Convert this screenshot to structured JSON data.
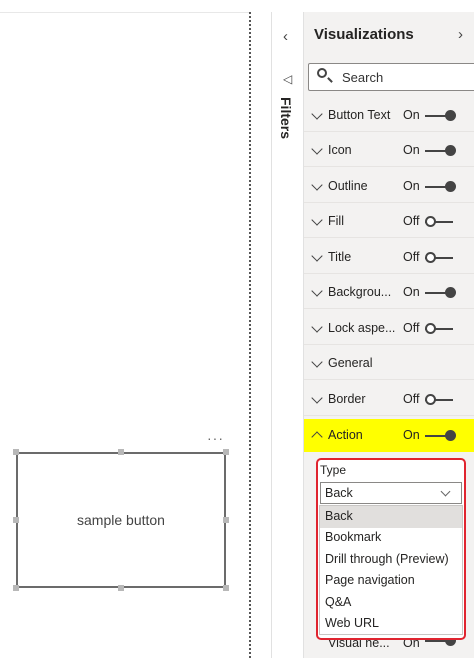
{
  "canvas": {
    "button_text": "sample button",
    "more_options": "···"
  },
  "filters_pane": {
    "label": "Filters",
    "collapse_chevron": "‹",
    "filter_icon": "◁"
  },
  "visualizations": {
    "title": "Visualizations",
    "collapse_chevron": "›",
    "search_placeholder": "Search",
    "sections": [
      {
        "label": "Button Text",
        "state": "On"
      },
      {
        "label": "Icon",
        "state": "On"
      },
      {
        "label": "Outline",
        "state": "On"
      },
      {
        "label": "Fill",
        "state": "Off"
      },
      {
        "label": "Title",
        "state": "Off"
      },
      {
        "label": "Backgrou...",
        "state": "On"
      },
      {
        "label": "Lock aspe...",
        "state": "Off"
      },
      {
        "label": "General",
        "state": ""
      },
      {
        "label": "Border",
        "state": "Off"
      },
      {
        "label": "Action",
        "state": "On"
      }
    ],
    "action": {
      "type_label": "Type",
      "selected_value": "Back",
      "options": [
        "Back",
        "Bookmark",
        "Drill through (Preview)",
        "Page navigation",
        "Q&A",
        "Web URL"
      ]
    },
    "partial_section": {
      "label": "Visual he...",
      "state": "On"
    }
  },
  "colors": {
    "highlight": "#ffff00",
    "outline_red": "#e0242f",
    "pane_bg": "#f3f2f1"
  }
}
